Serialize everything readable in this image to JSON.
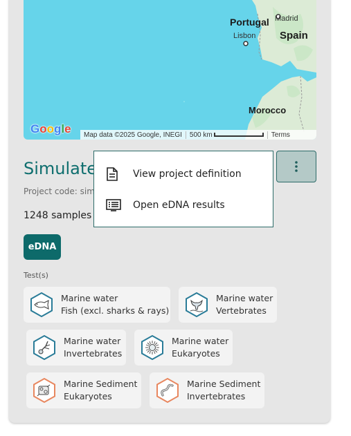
{
  "map": {
    "labels": {
      "portugal": "Portugal",
      "madrid": "Madrid",
      "lisbon": "Lisbon",
      "spain": "Spain",
      "morocco": "Morocco"
    },
    "google_logo": "Google",
    "attribution": "Map data ©2025 Google, INEGI",
    "scale": "500 km",
    "terms": "Terms"
  },
  "project": {
    "title": "Simulate",
    "code": "Project code: sim",
    "samples": "1248 samples",
    "badge": "eDNA",
    "tests_label": "Test(s)"
  },
  "menu": {
    "items": [
      {
        "label": "View project definition",
        "icon": "document-icon"
      },
      {
        "label": "Open eDNA results",
        "icon": "list-icon"
      }
    ]
  },
  "tests": [
    {
      "line1": "Marine water",
      "line2": "Fish (excl. sharks & rays)",
      "icon": "fish-icon",
      "color": "#2a7c98"
    },
    {
      "line1": "Marine water",
      "line2": "Vertebrates",
      "icon": "whale-tail-icon",
      "color": "#2a7c98"
    },
    {
      "line1": "Marine water",
      "line2": "Invertebrates",
      "icon": "invertebrate-icon",
      "color": "#2a7c98"
    },
    {
      "line1": "Marine water",
      "line2": "Eukaryotes",
      "icon": "plankton-icon",
      "color": "#2a7c98"
    },
    {
      "line1": "Marine Sediment",
      "line2": "Eukaryotes",
      "icon": "sediment-eukaryote-icon",
      "color": "#e8875f"
    },
    {
      "line1": "Marine Sediment",
      "line2": "Invertebrates",
      "icon": "worm-icon",
      "color": "#e8875f"
    }
  ]
}
